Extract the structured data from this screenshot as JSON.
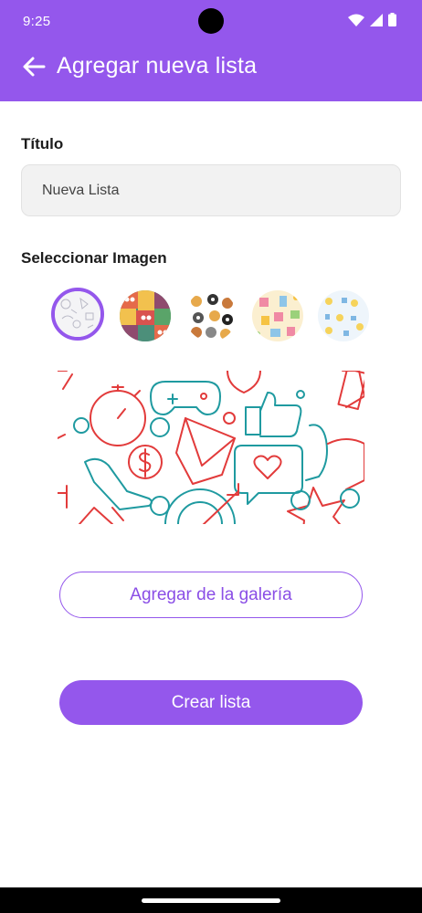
{
  "status_bar": {
    "time": "9:25",
    "icons": [
      "wifi-icon",
      "signal-icon",
      "battery-icon"
    ]
  },
  "app_bar": {
    "title": "Agregar nueva lista",
    "back_icon": "arrow-left-icon",
    "background": "#9457ec"
  },
  "form": {
    "title_label": "Título",
    "title_value": "Nueva Lista",
    "image_label": "Seleccionar Imagen",
    "images": [
      {
        "name": "doodle-pattern",
        "selected": true
      },
      {
        "name": "monster-cats-pattern",
        "selected": false
      },
      {
        "name": "dogs-pattern",
        "selected": false
      },
      {
        "name": "gifts-pattern",
        "selected": false
      },
      {
        "name": "lightbulbs-pattern",
        "selected": false
      }
    ],
    "preview_name": "social-media-icons-pattern"
  },
  "buttons": {
    "gallery_label": "Agregar de la galería",
    "create_label": "Crear lista"
  },
  "colors": {
    "accent": "#9457ec",
    "preview_red": "#e23b3b",
    "preview_teal": "#1f9aa0"
  }
}
